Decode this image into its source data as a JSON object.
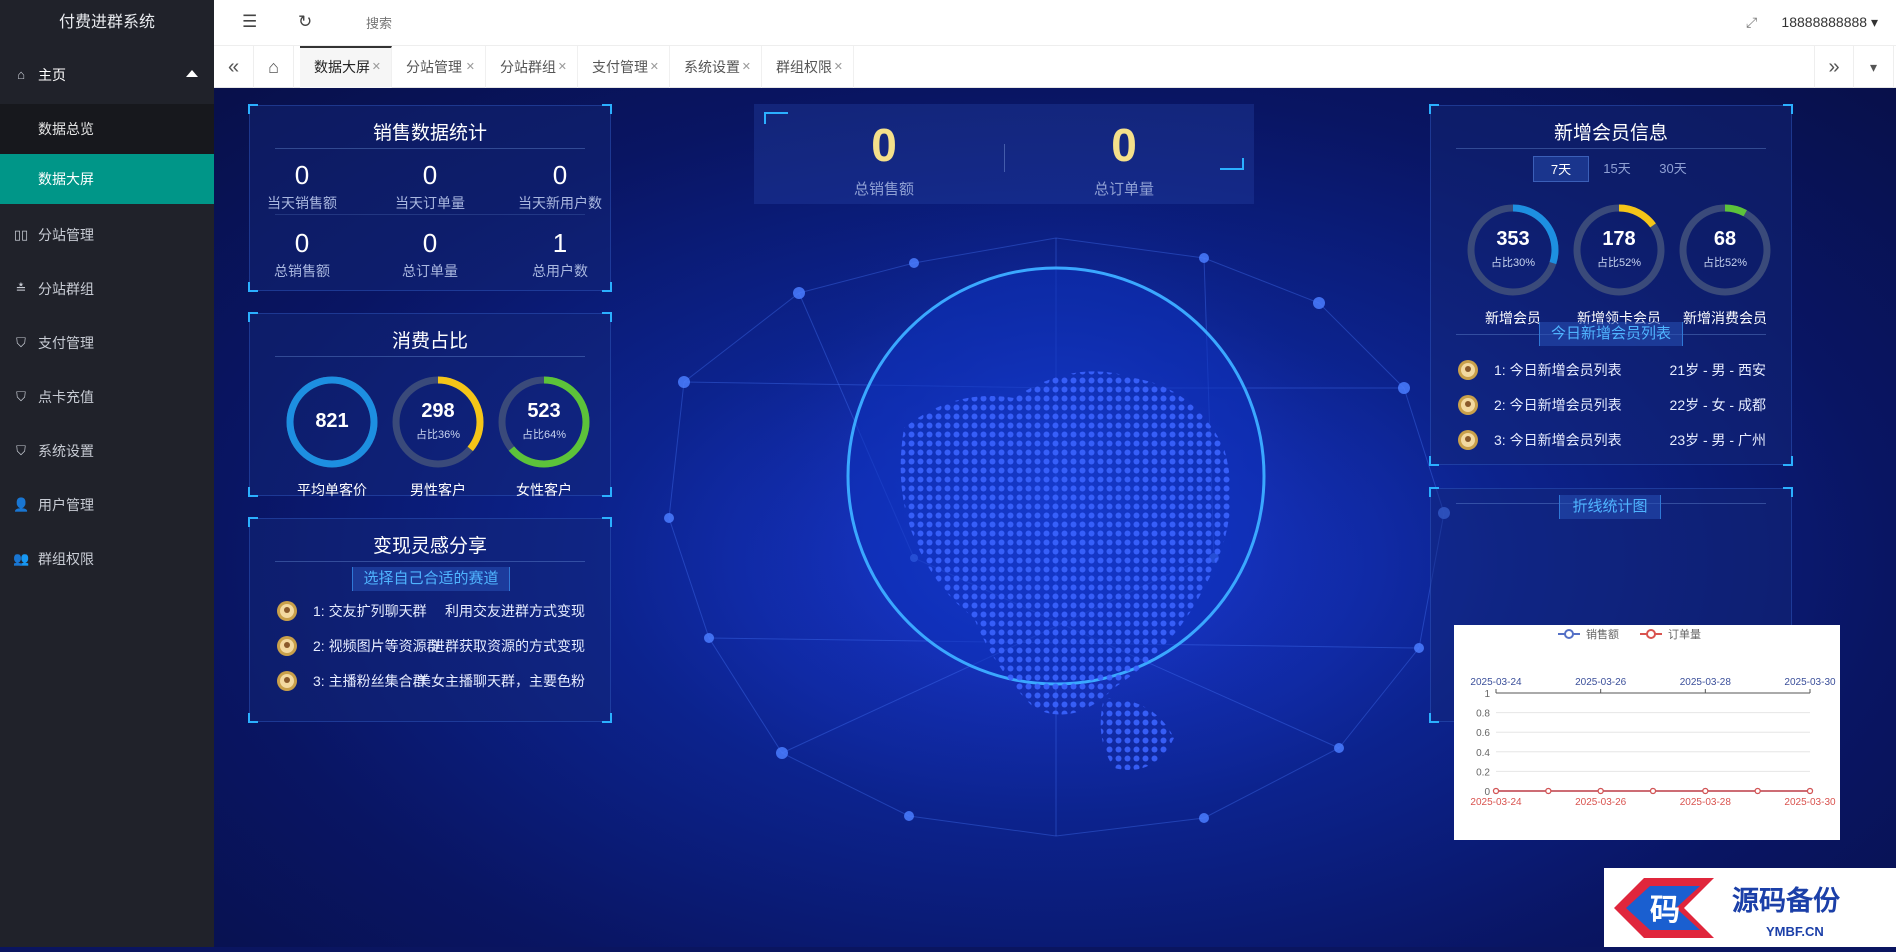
{
  "app": {
    "title": "付费进群系统"
  },
  "sidebar": {
    "home": "主页",
    "sub_items": [
      "数据总览",
      "数据大屏"
    ],
    "items": [
      {
        "label": "分站管理",
        "icon": "columns-icon"
      },
      {
        "label": "分站群组",
        "icon": "sliders-icon"
      },
      {
        "label": "支付管理",
        "icon": "shield-icon"
      },
      {
        "label": "点卡充值",
        "icon": "shield-icon"
      },
      {
        "label": "系统设置",
        "icon": "shield-icon"
      },
      {
        "label": "用户管理",
        "icon": "user-icon"
      },
      {
        "label": "群组权限",
        "icon": "users-icon"
      }
    ]
  },
  "topbar": {
    "search_placeholder": "搜索",
    "user": "18888888888"
  },
  "tabs": [
    "数据大屏",
    "分站管理",
    "分站群组",
    "支付管理",
    "系统设置",
    "群组权限"
  ],
  "sales": {
    "title": "销售数据统计",
    "row1": [
      {
        "num": "0",
        "label": "当天销售额"
      },
      {
        "num": "0",
        "label": "当天订单量"
      },
      {
        "num": "0",
        "label": "当天新用户数"
      }
    ],
    "row2": [
      {
        "num": "0",
        "label": "总销售额"
      },
      {
        "num": "0",
        "label": "总订单量"
      },
      {
        "num": "1",
        "label": "总用户数"
      }
    ]
  },
  "consume": {
    "title": "消费占比",
    "rings": [
      {
        "value": "821",
        "pct": "",
        "label": "平均单客价",
        "fraction": 1.0,
        "color": "#1d8fe1"
      },
      {
        "value": "298",
        "pct": "占比36%",
        "label": "男性客户",
        "fraction": 0.36,
        "color": "#f5c518"
      },
      {
        "value": "523",
        "pct": "占比64%",
        "label": "女性客户",
        "fraction": 0.64,
        "color": "#5cc33a"
      }
    ]
  },
  "ideas": {
    "title": "变现灵感分享",
    "subtitle": "选择自己合适的赛道",
    "items": [
      {
        "left": "1:  交友扩列聊天群",
        "right": "利用交友进群方式变现"
      },
      {
        "left": "2:  视频图片等资源群",
        "right": "进群获取资源的方式变现"
      },
      {
        "left": "3:  主播粉丝集合群",
        "right": "美女主播聊天群，主要色粉"
      }
    ]
  },
  "center": {
    "total_sales": {
      "num": "0",
      "label": "总销售额"
    },
    "total_orders": {
      "num": "0",
      "label": "总订单量"
    }
  },
  "members": {
    "title": "新增会员信息",
    "ranges": [
      "7天",
      "15天",
      "30天"
    ],
    "rings": [
      {
        "value": "353",
        "pct": "占比30%",
        "label": "新增会员",
        "fraction": 0.3,
        "color": "#1d8fe1"
      },
      {
        "value": "178",
        "pct": "占比52%",
        "label": "新增领卡会员",
        "fraction": 0.15,
        "color": "#f5c518"
      },
      {
        "value": "68",
        "pct": "占比52%",
        "label": "新增消费会员",
        "fraction": 0.08,
        "color": "#5cc33a"
      }
    ],
    "list_title": "今日新增会员列表",
    "list": [
      {
        "left": "1:  今日新增会员列表",
        "right": "21岁 - 男 - 西安"
      },
      {
        "left": "2:  今日新增会员列表",
        "right": "22岁 - 女 - 成都"
      },
      {
        "left": "3:  今日新增会员列表",
        "right": "23岁 - 男 - 广州"
      }
    ]
  },
  "line_chart_title": "折线统计图",
  "chart_data": {
    "type": "line",
    "x": [
      "2025-03-24",
      "2025-03-25",
      "2025-03-26",
      "2025-03-27",
      "2025-03-28",
      "2025-03-29",
      "2025-03-30"
    ],
    "x_tick_labels": [
      "2025-03-24",
      "2025-03-26",
      "2025-03-28",
      "2025-03-30"
    ],
    "series": [
      {
        "name": "销售额",
        "values": [
          0,
          0,
          0,
          0,
          0,
          0,
          0
        ],
        "color": "#5470c6"
      },
      {
        "name": "订单量",
        "values": [
          0,
          0,
          0,
          0,
          0,
          0,
          0
        ],
        "color": "#d9534f"
      }
    ],
    "ylim": [
      0,
      1
    ],
    "y_ticks": [
      "1",
      "0.8",
      "0.6",
      "0.4",
      "0.2",
      "0"
    ],
    "legend": "top-center",
    "grid": true
  },
  "watermark": {
    "char": "码",
    "title": "源码备份",
    "url": "YMBF.CN"
  }
}
